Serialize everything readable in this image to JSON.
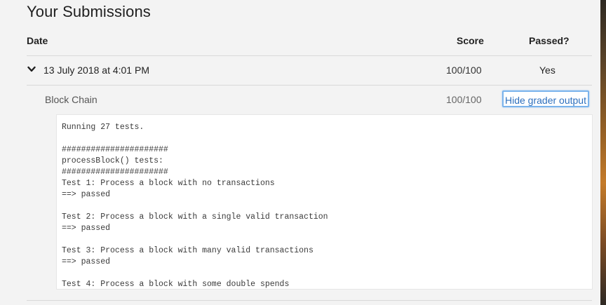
{
  "page": {
    "title": "Your Submissions"
  },
  "table": {
    "headers": {
      "date": "Date",
      "score": "Score",
      "passed": "Passed?"
    },
    "submission": {
      "date": "13 July 2018 at 4:01 PM",
      "score": "100/100",
      "passed": "Yes",
      "expanded_icon": "chevron-down-icon"
    },
    "detail": {
      "name": "Block Chain",
      "score": "100/100",
      "toggle_label": "Hide grader output"
    }
  },
  "grader_output": {
    "lines": [
      "Running 27 tests.",
      "",
      "######################",
      "processBlock() tests:",
      "######################",
      "Test 1: Process a block with no transactions",
      "==> passed",
      "",
      "Test 2: Process a block with a single valid transaction",
      "==> passed",
      "",
      "Test 3: Process a block with many valid transactions",
      "==> passed",
      "",
      "Test 4: Process a block with some double spends"
    ]
  },
  "colors": {
    "link": "#2d6fbd",
    "focus_border": "#7ab3ec",
    "background": "#f3f3f3",
    "divider": "#d9d9d9"
  }
}
